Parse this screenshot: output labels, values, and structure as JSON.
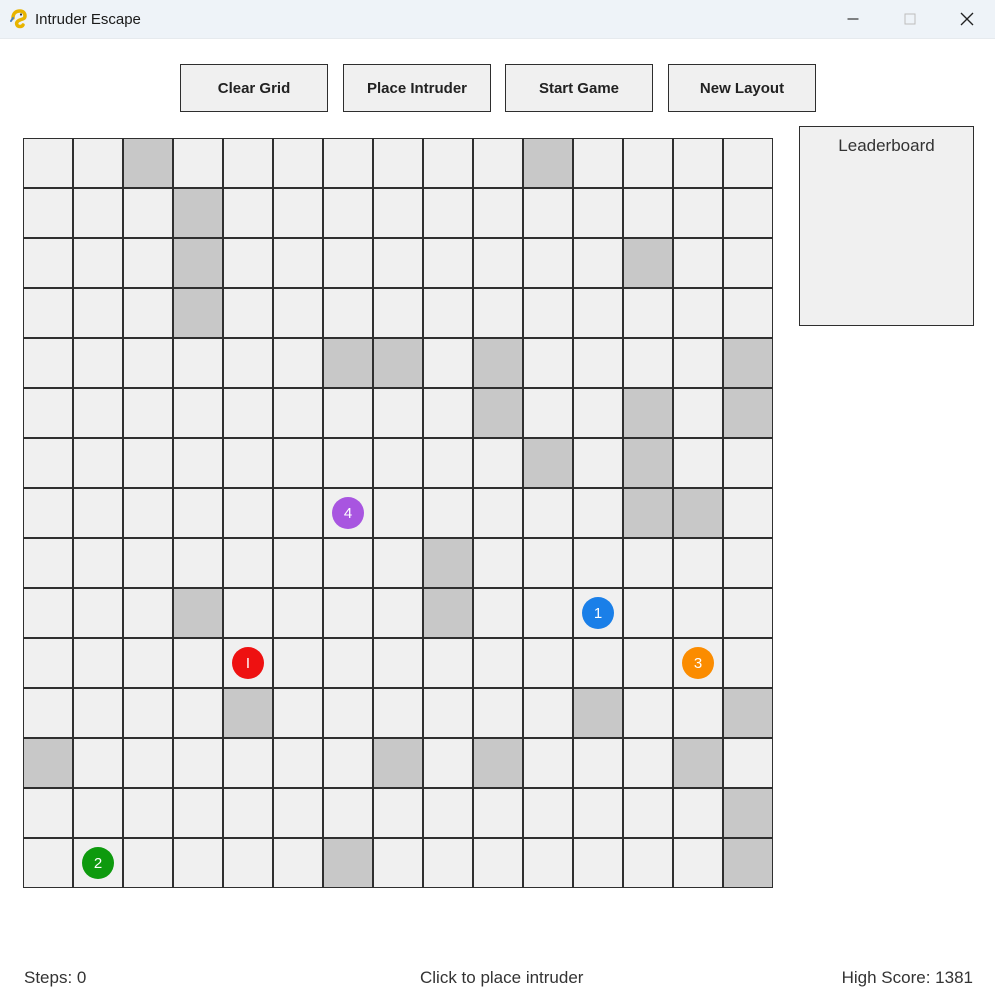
{
  "window": {
    "title": "Intruder Escape",
    "icon": "python-snake-icon"
  },
  "toolbar": {
    "clear_grid": "Clear Grid",
    "place_intruder": "Place Intruder",
    "start_game": "Start Game",
    "new_layout": "New Layout"
  },
  "grid": {
    "rows": 15,
    "cols": 15,
    "walls": [
      [
        0,
        2
      ],
      [
        0,
        10
      ],
      [
        1,
        3
      ],
      [
        2,
        3
      ],
      [
        2,
        12
      ],
      [
        3,
        3
      ],
      [
        4,
        6
      ],
      [
        4,
        7
      ],
      [
        4,
        9
      ],
      [
        4,
        14
      ],
      [
        5,
        9
      ],
      [
        5,
        12
      ],
      [
        5,
        14
      ],
      [
        6,
        10
      ],
      [
        6,
        12
      ],
      [
        7,
        12
      ],
      [
        7,
        13
      ],
      [
        8,
        8
      ],
      [
        9,
        3
      ],
      [
        9,
        8
      ],
      [
        11,
        4
      ],
      [
        11,
        11
      ],
      [
        11,
        14
      ],
      [
        12,
        0
      ],
      [
        12,
        7
      ],
      [
        12,
        9
      ],
      [
        12,
        13
      ],
      [
        13,
        14
      ],
      [
        14,
        6
      ],
      [
        14,
        14
      ]
    ],
    "agents": [
      {
        "label": "4",
        "row": 7,
        "col": 6,
        "color": "#a855e0"
      },
      {
        "label": "1",
        "row": 9,
        "col": 11,
        "color": "#1a7fe8"
      },
      {
        "label": "I",
        "row": 10,
        "col": 4,
        "color": "#ee1111"
      },
      {
        "label": "3",
        "row": 10,
        "col": 13,
        "color": "#fb8c00"
      },
      {
        "label": "2",
        "row": 14,
        "col": 1,
        "color": "#0e9a0e"
      }
    ]
  },
  "leaderboard": {
    "title": "Leaderboard"
  },
  "status": {
    "steps": "Steps: 0",
    "message": "Click to place intruder",
    "high_score": "High Score: 1381"
  }
}
